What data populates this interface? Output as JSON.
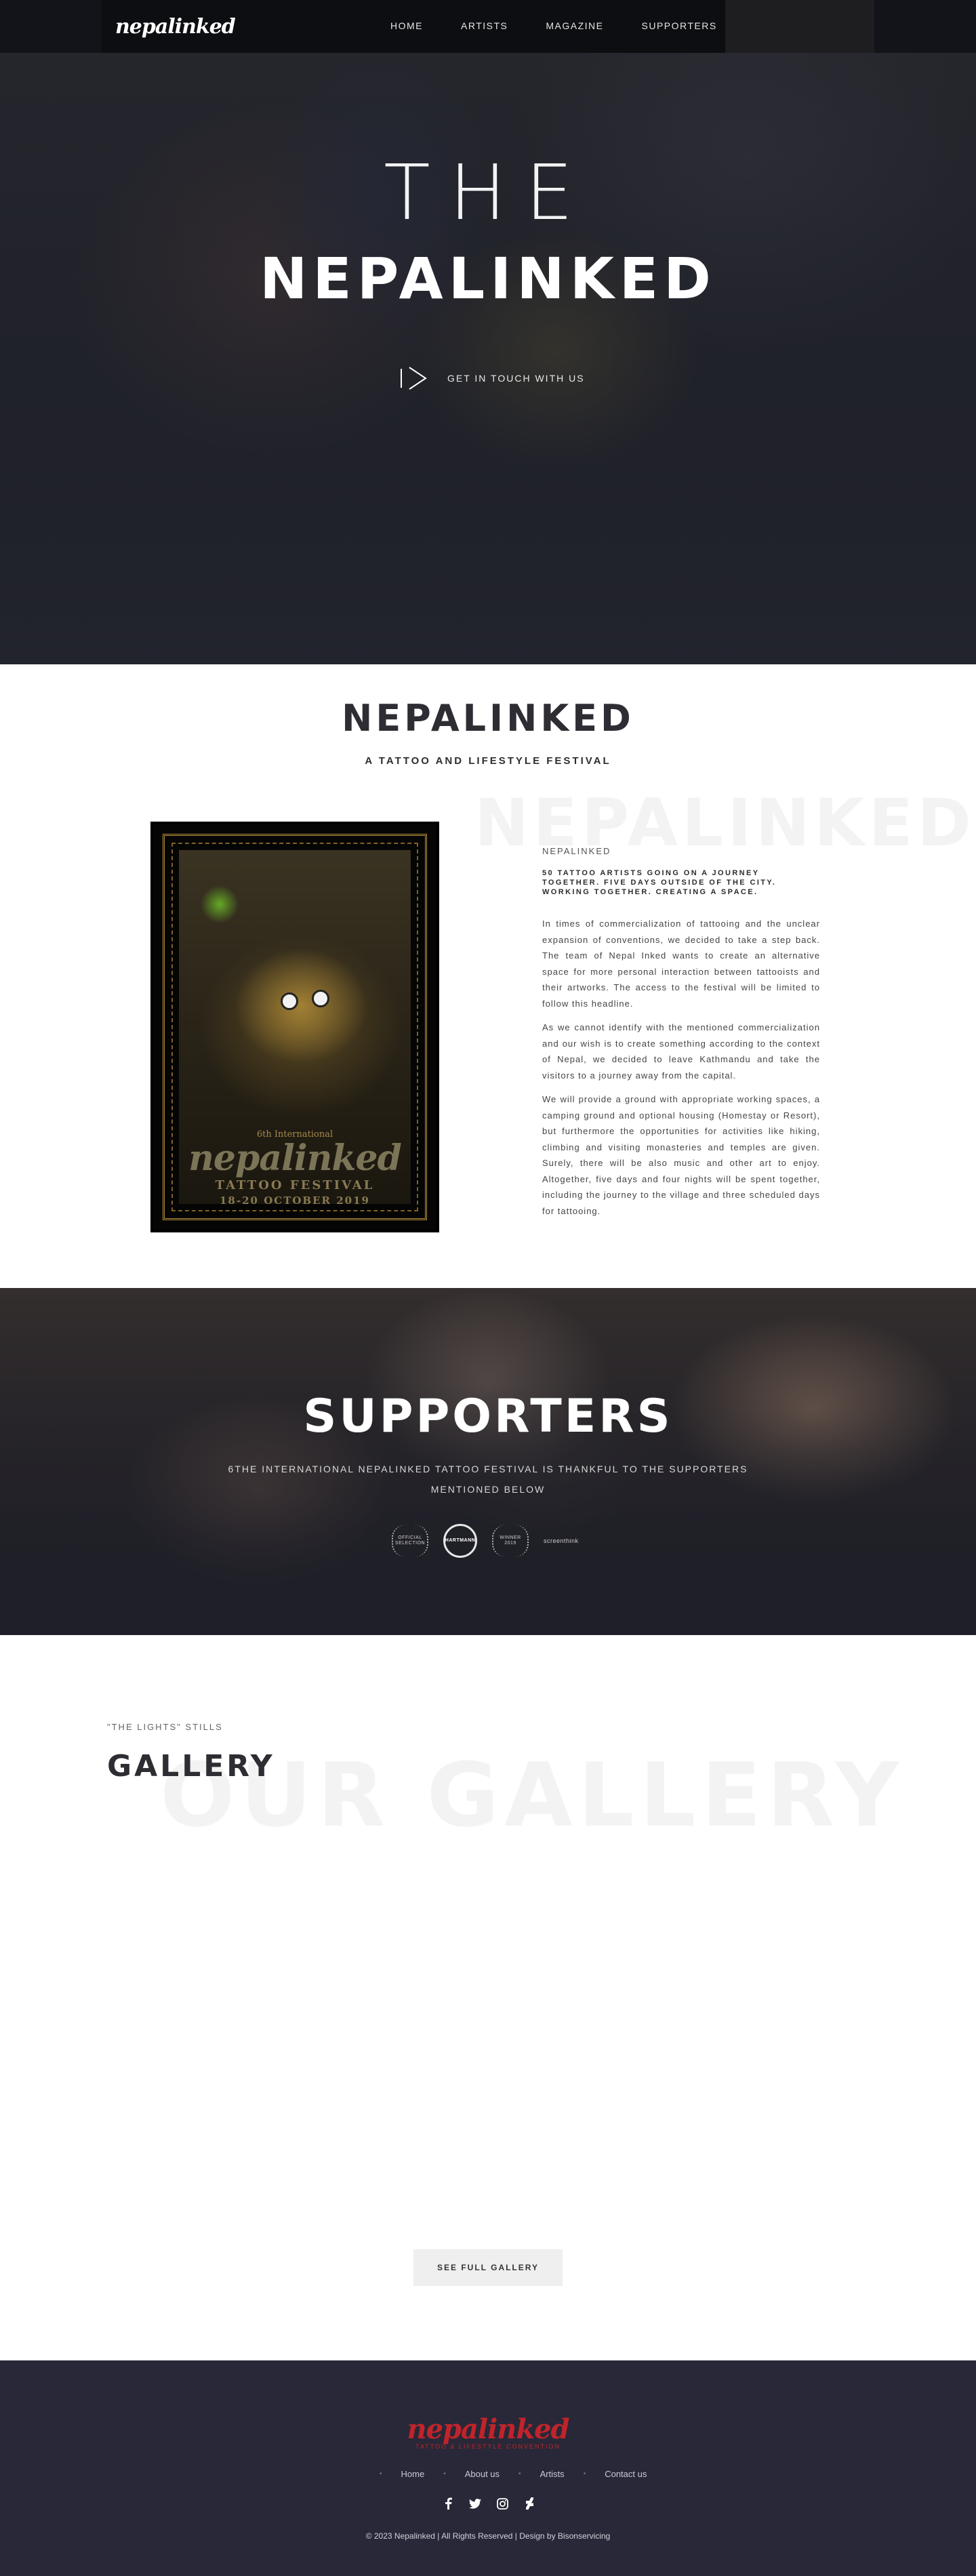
{
  "nav": {
    "logo": "nepalinked",
    "links": [
      "HOME",
      "ARTISTS",
      "MAGAZINE",
      "SUPPORTERS"
    ]
  },
  "hero": {
    "title_line1": "THE",
    "title_line2": "NEPALINKED",
    "cta_label": "GET IN TOUCH WITH US",
    "cta_icon": "play-icon"
  },
  "about": {
    "title": "NEPALINKED",
    "subtitle": "A TATTOO AND LIFESTYLE FESTIVAL",
    "watermark": "NEPALINKED",
    "label": "NEPALINKED",
    "tagline": "50 TATTOO ARTISTS GOING ON A JOURNEY TOGETHER. FIVE DAYS OUTSIDE OF THE CITY. WORKING TOGETHER. CREATING A SPACE.",
    "paragraphs": [
      "In times of commercialization of tattooing and the unclear expansion of conventions, we decided to take a step back. The team of Nepal Inked wants to create an alternative space for more personal interaction between tattooists and their artworks. The access to the festival will be limited to follow this headline.",
      "As we cannot identify with the mentioned commercialization and our wish is to create something according to the context of Nepal, we decided to leave Kathmandu and take the visitors to a journey away from the capital.",
      "We will provide a ground with appropriate working spaces, a camping ground and optional housing (Homestay or Resort), but furthermore the opportunities for activities like hiking, climbing and visiting monasteries and temples are given. Surely, there will be also music and other art to enjoy. Altogether, five days and four nights will be spent together, including the journey to the village and three scheduled days for tattooing."
    ],
    "poster": {
      "small_text": "6th International",
      "logo": "nepalinked",
      "line1": "TATTOO FESTIVAL",
      "line2": "18-20 OCTOBER 2019"
    }
  },
  "supporters": {
    "title": "SUPPORTERS",
    "text": "6THE INTERNATIONAL NEPALINKED TATTOO FESTIVAL IS THANKFUL TO THE SUPPORTERS MENTIONED BELOW",
    "badges": [
      {
        "label": "OFFICIAL SELECTION",
        "icon": "laurel-badge-icon"
      },
      {
        "label": "HARTMANN",
        "icon": "circle-logo-icon"
      },
      {
        "label": "WINNER 2019",
        "icon": "laurel-award-icon"
      },
      {
        "label": "screenthink",
        "icon": "text-logo-icon"
      }
    ]
  },
  "gallery": {
    "kicker": "\"THE LIGHTS\" STILLS",
    "title": "GALLERY",
    "watermark": "OUR GALLERY",
    "button_label": "SEE FULL GALLERY"
  },
  "footer": {
    "logo": "nepalinked",
    "logo_sub": "TATTOO & LIFESTYLE CONVENTION",
    "links": [
      "Home",
      "About us",
      "Artists",
      "Contact us"
    ],
    "social": [
      {
        "name": "facebook-icon",
        "glyph": "f"
      },
      {
        "name": "twitter-icon",
        "glyph": "🐦"
      },
      {
        "name": "instagram-icon",
        "glyph": "◎"
      },
      {
        "name": "deviantart-icon",
        "glyph": "Ƶ"
      }
    ],
    "copyright": "© 2023 Nepalinked | All Rights Reserved | Design by Bisonservicing"
  }
}
